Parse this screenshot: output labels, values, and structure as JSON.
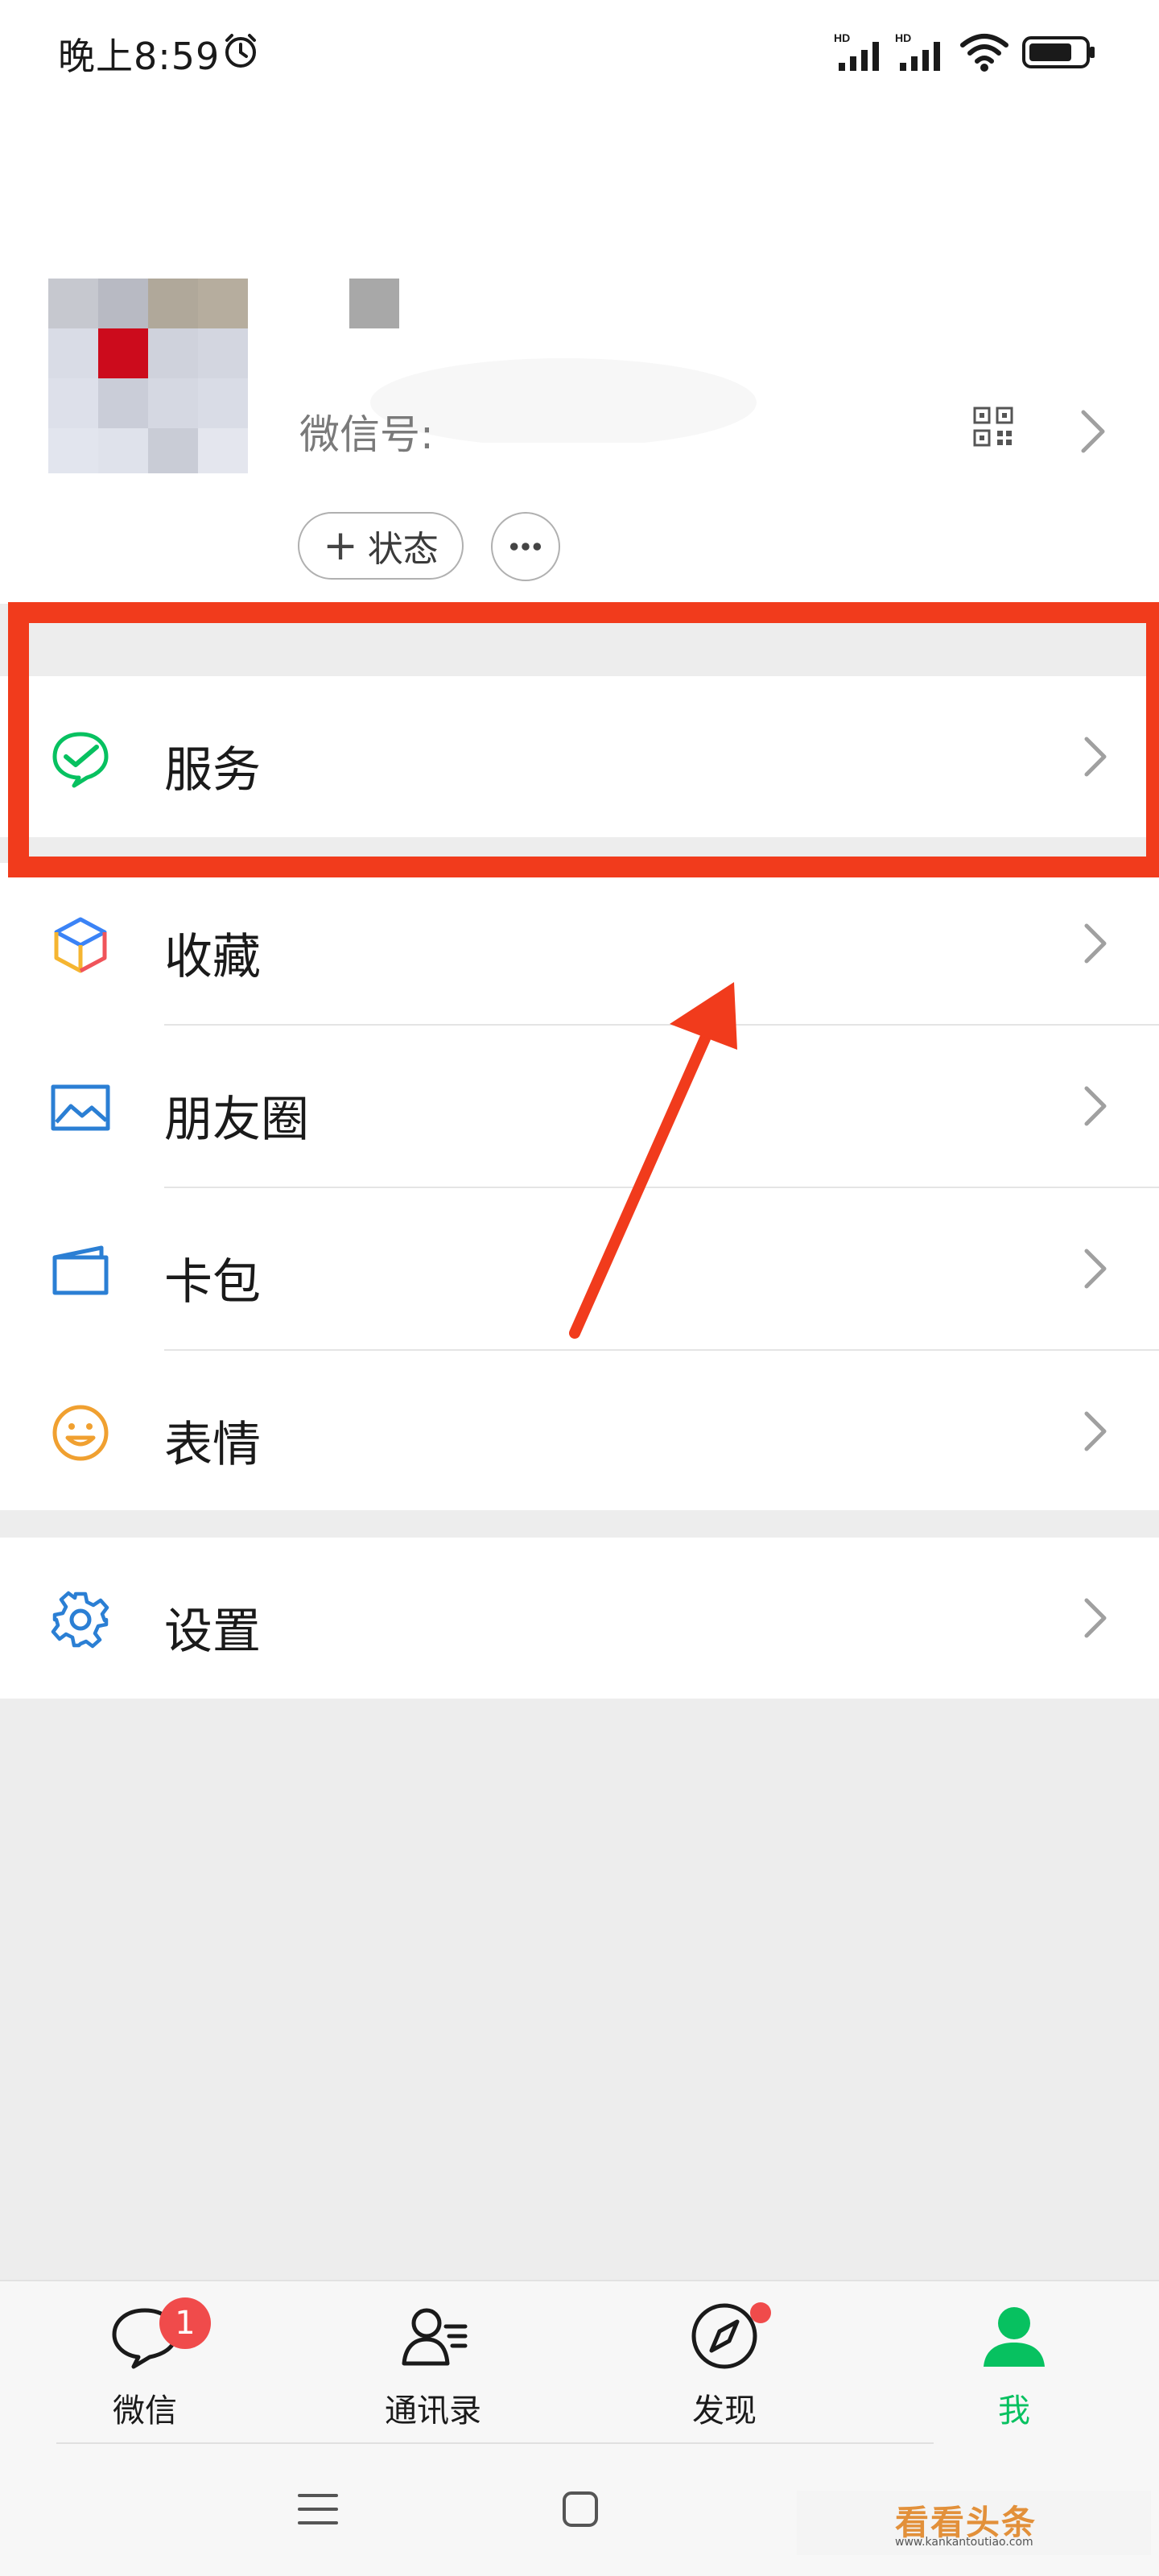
{
  "status_bar": {
    "time": "晚上8:59"
  },
  "profile": {
    "wechat_id_label": "微信号:",
    "status_label": "状态"
  },
  "menu": {
    "service": "服务",
    "favorites": "收藏",
    "moments": "朋友圈",
    "cards": "卡包",
    "stickers": "表情",
    "settings": "设置"
  },
  "tabs": [
    {
      "label": "微信"
    },
    {
      "label": "通讯录"
    },
    {
      "label": "发现"
    },
    {
      "label": "我"
    }
  ],
  "badge": {
    "chats_unread": "1"
  },
  "colors": {
    "accent": "#07c160",
    "annotation": "#f13b1c",
    "badge": "#f04b4b"
  },
  "watermark": {
    "text": "看看头条",
    "url": "www.kankantoutiao.com"
  }
}
